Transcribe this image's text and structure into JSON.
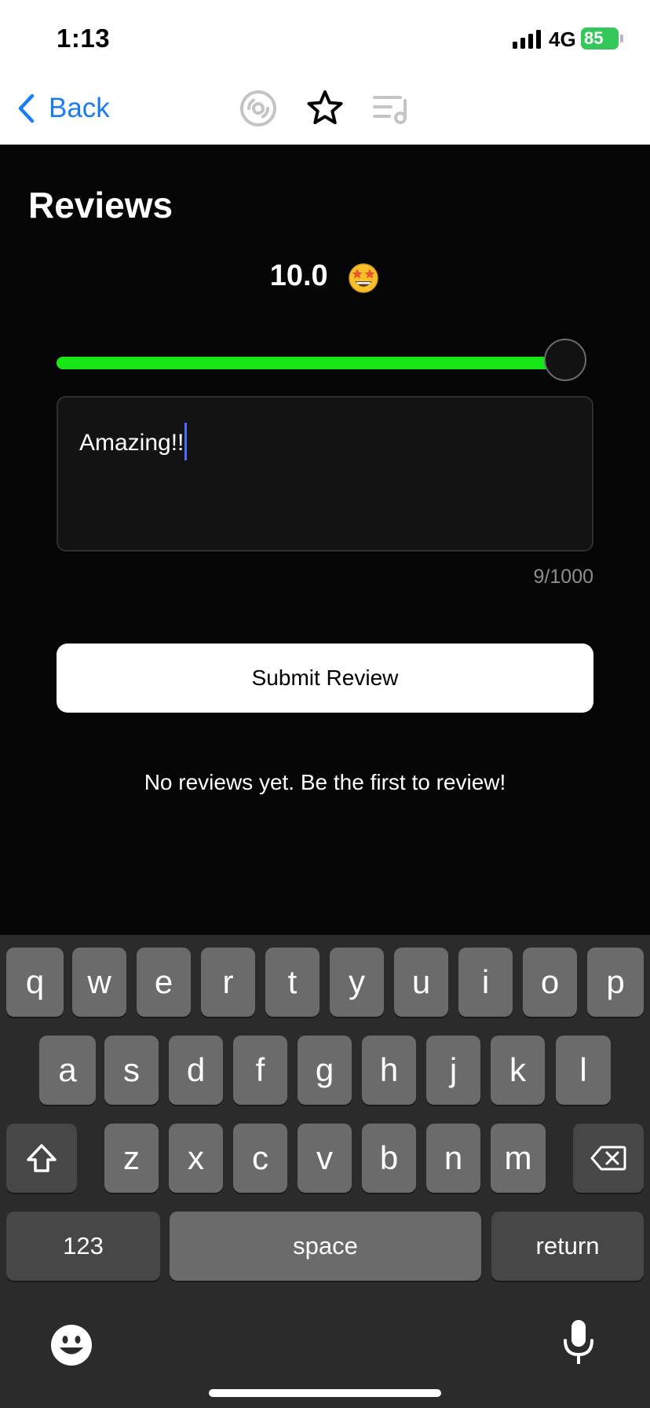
{
  "status_bar": {
    "time": "1:13",
    "network": "4G",
    "battery": "85"
  },
  "nav": {
    "back_label": "Back",
    "icons": [
      "vinyl-record-icon",
      "star-icon",
      "playlist-icon"
    ]
  },
  "page": {
    "title": "Reviews",
    "score": "10.0",
    "score_emoji": "star-struck-emoji",
    "rating_level": 1.0,
    "review_text": "Amazing!!",
    "char_counter": "9/1000",
    "submit_label": "Submit Review",
    "empty_message": "No reviews yet. Be the first to review!"
  },
  "keyboard": {
    "row1": [
      "q",
      "w",
      "e",
      "r",
      "t",
      "y",
      "u",
      "i",
      "o",
      "p"
    ],
    "row2": [
      "a",
      "s",
      "d",
      "f",
      "g",
      "h",
      "j",
      "k",
      "l"
    ],
    "row3": [
      "z",
      "x",
      "c",
      "v",
      "b",
      "n",
      "m"
    ],
    "numbers_label": "123",
    "space_label": "space",
    "return_label": "return"
  },
  "colors": {
    "accent": "#1a7df7",
    "slider": "#16e616",
    "battery": "#34c759"
  }
}
